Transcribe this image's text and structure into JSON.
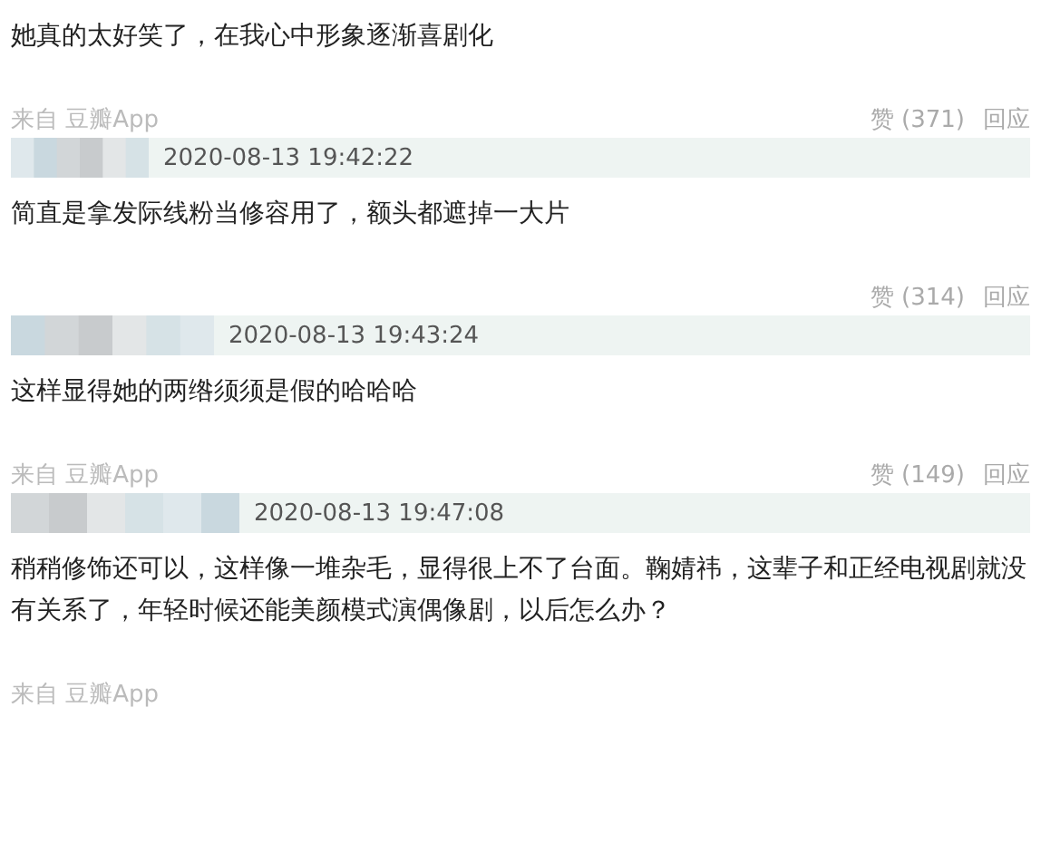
{
  "comments": [
    {
      "text": "她真的太好笑了，在我心中形象逐渐喜剧化",
      "source": "来自 豆瓣App",
      "likes": "赞 (371)",
      "reply": "回应"
    },
    {
      "header": {
        "time": "2020-08-13 19:42:22"
      },
      "text": "简直是拿发际线粉当修容用了，额头都遮掉一大片",
      "likes": "赞 (314)",
      "reply": "回应"
    },
    {
      "header": {
        "time": "2020-08-13 19:43:24"
      },
      "text": "这样显得她的两绺须须是假的哈哈哈",
      "source": "来自 豆瓣App",
      "likes": "赞 (149)",
      "reply": "回应"
    },
    {
      "header": {
        "time": "2020-08-13 19:47:08"
      },
      "text": "稍稍修饰还可以，这样像一堆杂毛，显得很上不了台面。鞠婧祎，这辈子和正经电视剧就没有关系了，年轻时候还能美颜模式演偶像剧，以后怎么办？",
      "source": "来自 豆瓣App"
    }
  ]
}
